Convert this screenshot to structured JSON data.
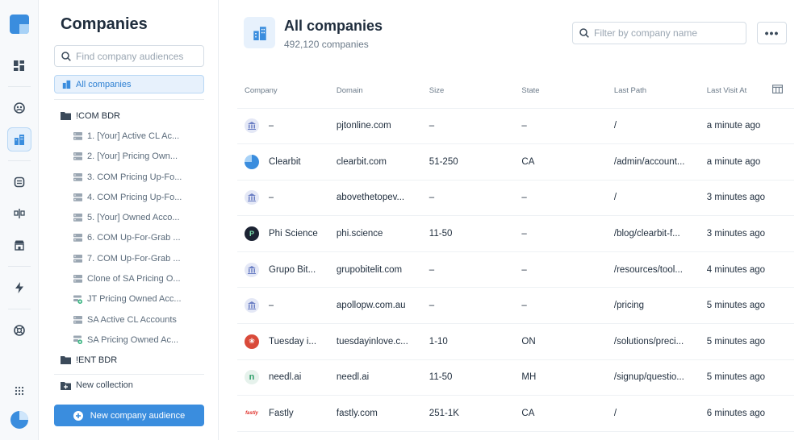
{
  "sidebar": {
    "title": "Companies",
    "search_placeholder": "Find company audiences",
    "all_companies": "All companies",
    "folders": [
      {
        "name": "!COM BDR",
        "items": [
          {
            "label": "1. [Your] Active CL Ac...",
            "icon": "list-icon"
          },
          {
            "label": "2. [Your] Pricing Own...",
            "icon": "list-icon"
          },
          {
            "label": "3. COM Pricing Up-Fo...",
            "icon": "list-icon"
          },
          {
            "label": "4. COM Pricing Up-Fo...",
            "icon": "list-icon"
          },
          {
            "label": "5. [Your] Owned Acco...",
            "icon": "list-icon"
          },
          {
            "label": "6. COM Up-For-Grab ...",
            "icon": "list-icon"
          },
          {
            "label": "7. COM Up-For-Grab ...",
            "icon": "list-icon"
          },
          {
            "label": "Clone of SA Pricing O...",
            "icon": "list-icon"
          },
          {
            "label": "JT Pricing Owned Acc...",
            "icon": "list-sync-icon"
          },
          {
            "label": "SA Active CL Accounts",
            "icon": "list-icon"
          },
          {
            "label": "SA Pricing Owned Ac...",
            "icon": "list-sync-icon"
          }
        ]
      },
      {
        "name": "!ENT BDR",
        "items": []
      }
    ],
    "new_collection": "New collection",
    "new_audience": "New company audience"
  },
  "header": {
    "title": "All companies",
    "count": "492,120 companies",
    "filter_placeholder": "Filter by company name",
    "more": "•••"
  },
  "table": {
    "columns": [
      "Company",
      "Domain",
      "Size",
      "State",
      "Last Path",
      "Last Visit At"
    ],
    "rows": [
      {
        "logo": "generic",
        "company": "–",
        "domain": "pjtonline.com",
        "size": "–",
        "state": "–",
        "path": "/",
        "visit": "a minute ago"
      },
      {
        "logo": "clearbit",
        "company": "Clearbit",
        "domain": "clearbit.com",
        "size": "51-250",
        "state": "CA",
        "path": "/admin/account...",
        "visit": "a minute ago"
      },
      {
        "logo": "generic",
        "company": "–",
        "domain": "abovethetopev...",
        "size": "–",
        "state": "–",
        "path": "/",
        "visit": "3 minutes ago"
      },
      {
        "logo": "phi",
        "company": "Phi Science",
        "domain": "phi.science",
        "size": "11-50",
        "state": "–",
        "path": "/blog/clearbit-f...",
        "visit": "3 minutes ago"
      },
      {
        "logo": "generic",
        "company": "Grupo Bit...",
        "domain": "grupobitelit.com",
        "size": "–",
        "state": "–",
        "path": "/resources/tool...",
        "visit": "4 minutes ago"
      },
      {
        "logo": "generic",
        "company": "–",
        "domain": "apollopw.com.au",
        "size": "–",
        "state": "–",
        "path": "/pricing",
        "visit": "5 minutes ago"
      },
      {
        "logo": "tuesday",
        "company": "Tuesday i...",
        "domain": "tuesdayinlove.c...",
        "size": "1-10",
        "state": "ON",
        "path": "/solutions/preci...",
        "visit": "5 minutes ago"
      },
      {
        "logo": "needl",
        "company": "needl.ai",
        "domain": "needl.ai",
        "size": "11-50",
        "state": "MH",
        "path": "/signup/questio...",
        "visit": "5 minutes ago"
      },
      {
        "logo": "fastly",
        "company": "Fastly",
        "domain": "fastly.com",
        "size": "251-1K",
        "state": "CA",
        "path": "/",
        "visit": "6 minutes ago"
      }
    ]
  },
  "logo_text": {
    "phi": "P",
    "tuesday": "❀",
    "needl": "n",
    "fastly": "fastly"
  },
  "colors": {
    "accent": "#3a8dde",
    "accent_light": "#e7f1fc",
    "text": "#1f2d3d",
    "muted": "#6b7a89"
  }
}
